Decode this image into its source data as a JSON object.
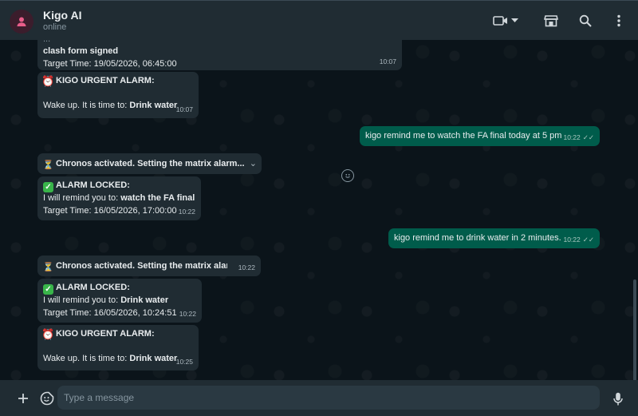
{
  "header": {
    "title": "Kigo AI",
    "status": "online"
  },
  "messages": [
    {
      "direction": "in",
      "line1_partial": "...",
      "bold_text": "clash form signed",
      "target": "Target Time: 19/05/2026, 06:45:00",
      "time": "10:07"
    },
    {
      "direction": "in",
      "heading": "KIGO URGENT ALARM:",
      "body_prefix": "Wake up. It is time to: ",
      "body_bold": "Drink water",
      "time": "10:07"
    },
    {
      "direction": "out",
      "text": "kigo remind me to watch the FA final today at 5 pm",
      "time": "10:22"
    },
    {
      "direction": "in",
      "text": "Chronos activated. Setting the matrix alarm...",
      "time": ""
    },
    {
      "direction": "in",
      "heading": "ALARM LOCKED:",
      "body_prefix": "I will remind you to: ",
      "body_bold": "watch the FA final",
      "target": "Target Time: 16/05/2026, 17:00:00",
      "time": "10:22"
    },
    {
      "direction": "out",
      "text": "kigo remind me to drink water in 2 minutes.",
      "time": "10:22"
    },
    {
      "direction": "in",
      "text": "Chronos activated. Setting the matrix alarm...",
      "time": "10:22"
    },
    {
      "direction": "in",
      "heading": "ALARM LOCKED:",
      "body_prefix": "I will remind you to: ",
      "body_bold": "Drink water",
      "target": "Target Time: 16/05/2026, 10:24:51",
      "time": "10:22"
    },
    {
      "direction": "in",
      "heading": "KIGO URGENT ALARM:",
      "body_prefix": "Wake up. It is time to: ",
      "body_bold": "Drink water",
      "time": "10:25"
    }
  ],
  "composer": {
    "placeholder": "Type a message"
  },
  "icons": {
    "avatar": "person-icon",
    "video": "video-call-icon",
    "dropdown": "chevron-down-icon",
    "store": "store-icon",
    "search": "search-icon",
    "menu": "more-vertical-icon",
    "add": "plus-icon",
    "sticker": "sticker-icon",
    "mic": "microphone-icon",
    "react": "emoji-react-icon"
  },
  "colors": {
    "incoming_bubble": "#202c33",
    "outgoing_bubble": "#005c4b",
    "chat_background": "#0b141a",
    "header": "#202c33"
  }
}
